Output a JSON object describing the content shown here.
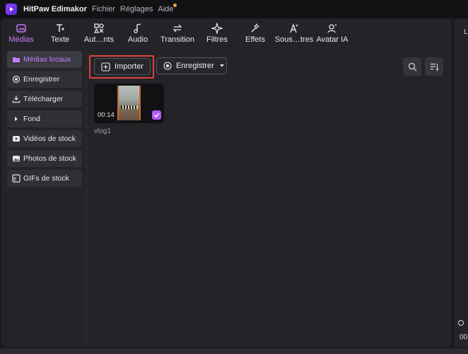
{
  "titlebar": {
    "app_name": "HitPaw Edimakor",
    "menus": [
      "Fichier",
      "Réglages",
      "Aide"
    ]
  },
  "toolbar": {
    "tools": [
      {
        "label": "Médias",
        "icon": "media-icon",
        "active": true
      },
      {
        "label": "Texte",
        "icon": "text-icon"
      },
      {
        "label": "Aut…nts",
        "icon": "elements-icon"
      },
      {
        "label": "Audio",
        "icon": "audio-icon"
      },
      {
        "label": "Transition",
        "icon": "transition-icon"
      },
      {
        "label": "Filtres",
        "icon": "filters-icon"
      },
      {
        "label": "Effets",
        "icon": "effects-icon"
      },
      {
        "label": "Sous…tres",
        "icon": "subtitles-icon"
      },
      {
        "label": "Avatar IA",
        "icon": "avatar-icon"
      }
    ]
  },
  "sidebar": {
    "items": [
      {
        "label": "Médias locaux",
        "icon": "folder-icon",
        "active": true
      },
      {
        "label": "Enregistrer",
        "icon": "record-icon"
      },
      {
        "label": "Télécharger",
        "icon": "download-icon"
      },
      {
        "label": "Fond",
        "icon": "play-icon"
      },
      {
        "label": "Vidéos de stock",
        "icon": "video-icon"
      },
      {
        "label": "Photos de stock",
        "icon": "image-icon"
      },
      {
        "label": "GIFs de stock",
        "icon": "gif-icon"
      }
    ]
  },
  "content": {
    "import_label": "Importer",
    "record_label": "Enregistrer",
    "media": [
      {
        "name": "vlog1",
        "duration": "00:14",
        "selected": true
      }
    ]
  },
  "right_panel": {
    "label": "Le",
    "time": "00"
  },
  "colors": {
    "accent": "#c77dff",
    "highlight": "#e0443a",
    "background": "#1a1a1e",
    "panel": "#232328"
  }
}
